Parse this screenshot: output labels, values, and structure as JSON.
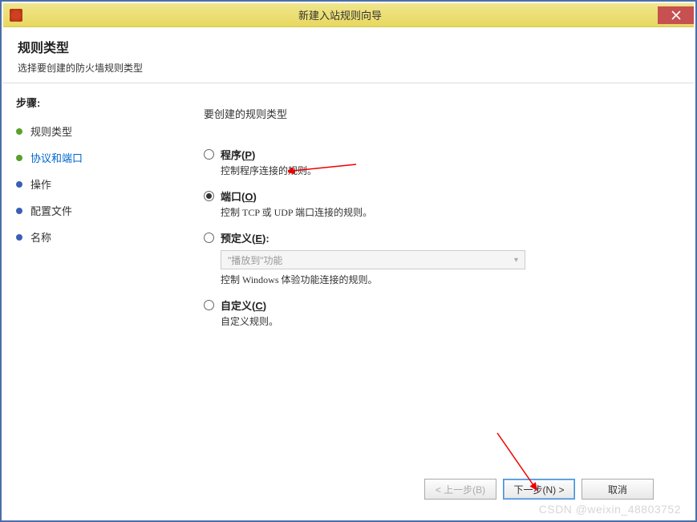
{
  "titlebar": {
    "title": "新建入站规则向导"
  },
  "header": {
    "title": "规则类型",
    "subtitle": "选择要创建的防火墙规则类型"
  },
  "sidebar": {
    "stepsLabel": "步骤:",
    "items": [
      {
        "label": "规则类型"
      },
      {
        "label": "协议和端口"
      },
      {
        "label": "操作"
      },
      {
        "label": "配置文件"
      },
      {
        "label": "名称"
      }
    ]
  },
  "main": {
    "prompt": "要创建的规则类型",
    "options": {
      "program": {
        "label_prefix": "程序(",
        "label_shortcut": "P",
        "label_suffix": ")",
        "desc": "控制程序连接的规则。"
      },
      "port": {
        "label_prefix": "端口(",
        "label_shortcut": "O",
        "label_suffix": ")",
        "desc": "控制 TCP 或 UDP 端口连接的规则。"
      },
      "predefined": {
        "label_prefix": "预定义(",
        "label_shortcut": "E",
        "label_suffix": "):",
        "dropdown_value": "\"播放到\"功能",
        "desc": "控制 Windows 体验功能连接的规则。"
      },
      "custom": {
        "label_prefix": "自定义(",
        "label_shortcut": "C",
        "label_suffix": ")",
        "desc": "自定义规则。"
      }
    }
  },
  "footer": {
    "back": "< 上一步(B)",
    "next": "下一步(N) >",
    "cancel": "取消"
  },
  "watermark": "CSDN @weixin_48803752"
}
